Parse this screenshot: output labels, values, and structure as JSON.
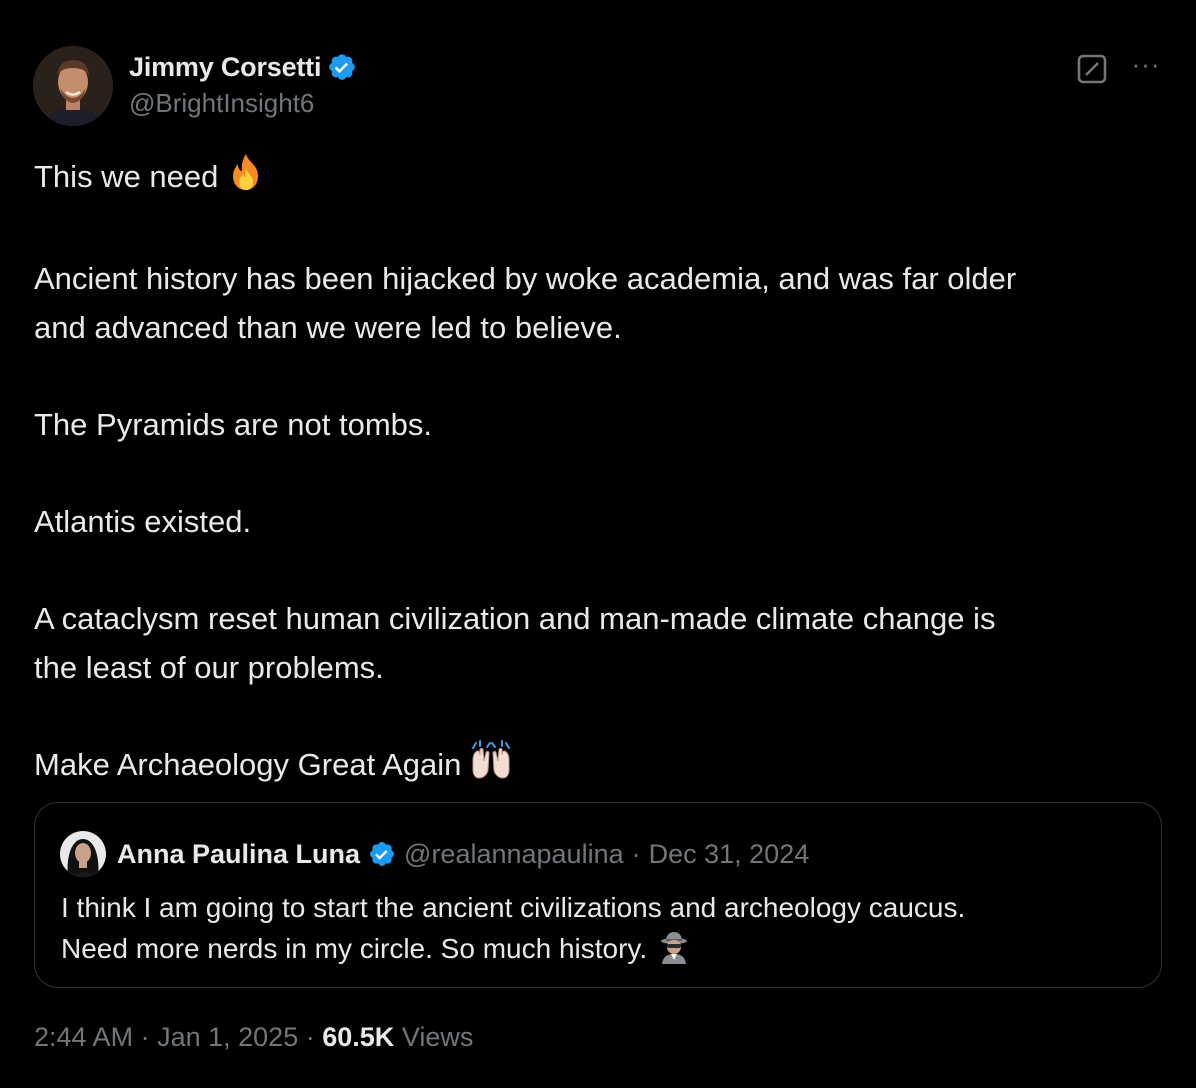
{
  "author": {
    "name": "Jimmy Corsetti",
    "handle": "@BrightInsight6",
    "verified": true
  },
  "actions": {
    "grok_icon": "grok-icon",
    "more_label": "···"
  },
  "body": {
    "paragraphs": [
      "This we need",
      "Ancient history has been hijacked by woke academia, and was far older\nand advanced than we were led to believe.",
      "The Pyramids are not tombs.",
      "Atlantis existed.",
      "A cataclysm reset human civilization and man-made climate change is\nthe least of our problems.",
      "Make Archaeology Great Again"
    ],
    "emoji_fire": "fire-emoji",
    "emoji_raised_hands": "raised-hands-emoji"
  },
  "quote": {
    "name": "Anna Paulina Luna",
    "verified": true,
    "handle": "@realannapaulina",
    "separator": "·",
    "date": "Dec 31, 2024",
    "lines": [
      "I think I am going to start the ancient civilizations and archeology caucus.",
      "Need more nerds in my circle. So much history."
    ],
    "emoji": "spy-emoji"
  },
  "meta": {
    "time": "2:44 AM",
    "separator": "·",
    "date": "Jan 1, 2025",
    "views_count": "60.5K",
    "views_label": "Views"
  },
  "colors": {
    "background": "#000000",
    "text_primary": "#e7e9ea",
    "text_secondary": "#71767b",
    "border": "#2f3336",
    "verified_blue": "#1d9bf0"
  }
}
